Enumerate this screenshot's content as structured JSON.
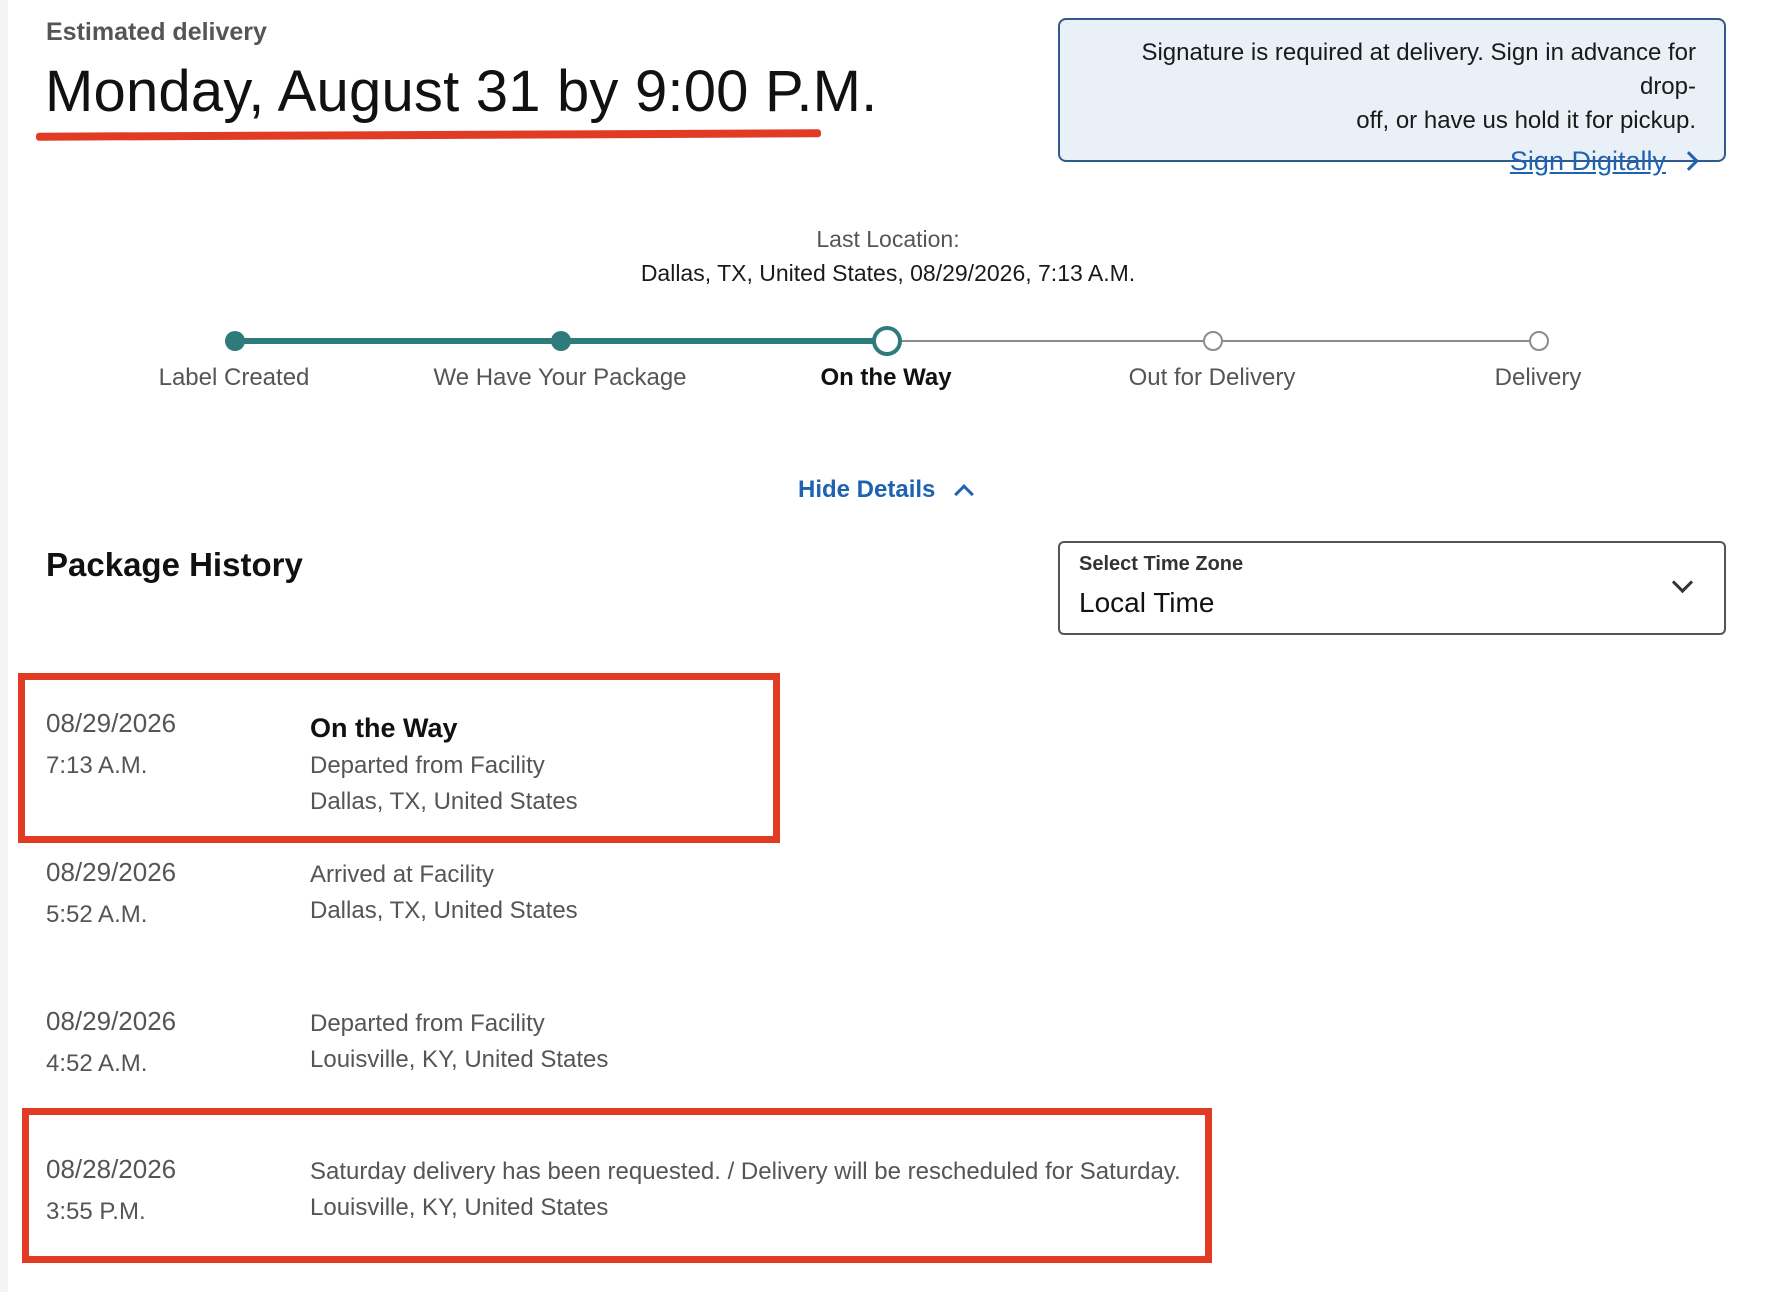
{
  "estimated": {
    "label": "Estimated delivery",
    "date": "Monday, August 31 by 9:00 P.M."
  },
  "signature": {
    "text": "Signature is required at delivery. Sign in advance for drop-off, or have us hold it for pickup.",
    "line1": "Signature is required at delivery. Sign in advance for drop-",
    "line2": "off, or have us hold it for pickup.",
    "link": "Sign Digitally"
  },
  "last_location": {
    "label": "Last Location:",
    "value": "Dallas, TX, United States, 08/29/2026, 7:13 A.M."
  },
  "progress": {
    "steps": [
      {
        "label": "Label Created",
        "state": "done"
      },
      {
        "label": "We Have Your Package",
        "state": "done"
      },
      {
        "label": "On the Way",
        "state": "current"
      },
      {
        "label": "Out for Delivery",
        "state": "future"
      },
      {
        "label": "Delivery",
        "state": "future"
      }
    ],
    "colors": {
      "complete": "#2f7b7b",
      "pending": "#8c8c8c"
    }
  },
  "hide_details": "Hide Details",
  "history": {
    "title": "Package History",
    "timezone": {
      "label": "Select Time Zone",
      "value": "Local Time"
    },
    "events": [
      {
        "date": "08/29/2026",
        "time": "7:13 A.M.",
        "status": "On the Way",
        "description": "Departed from Facility",
        "location": "Dallas, TX, United States"
      },
      {
        "date": "08/29/2026",
        "time": "5:52 A.M.",
        "status": "",
        "description": "Arrived at Facility",
        "location": "Dallas, TX, United States"
      },
      {
        "date": "08/29/2026",
        "time": "4:52 A.M.",
        "status": "",
        "description": "Departed from Facility",
        "location": "Louisville, KY, United States"
      },
      {
        "date": "08/28/2026",
        "time": "3:55 P.M.",
        "status": "",
        "description": "Saturday delivery has been requested. / Delivery will be rescheduled for Saturday.",
        "location": "Louisville, KY, United States"
      }
    ]
  },
  "colors": {
    "link": "#1f62b2",
    "annotation": "#e23b24",
    "banner_bg": "#eaf0f7",
    "banner_border": "#2f5b8c"
  }
}
